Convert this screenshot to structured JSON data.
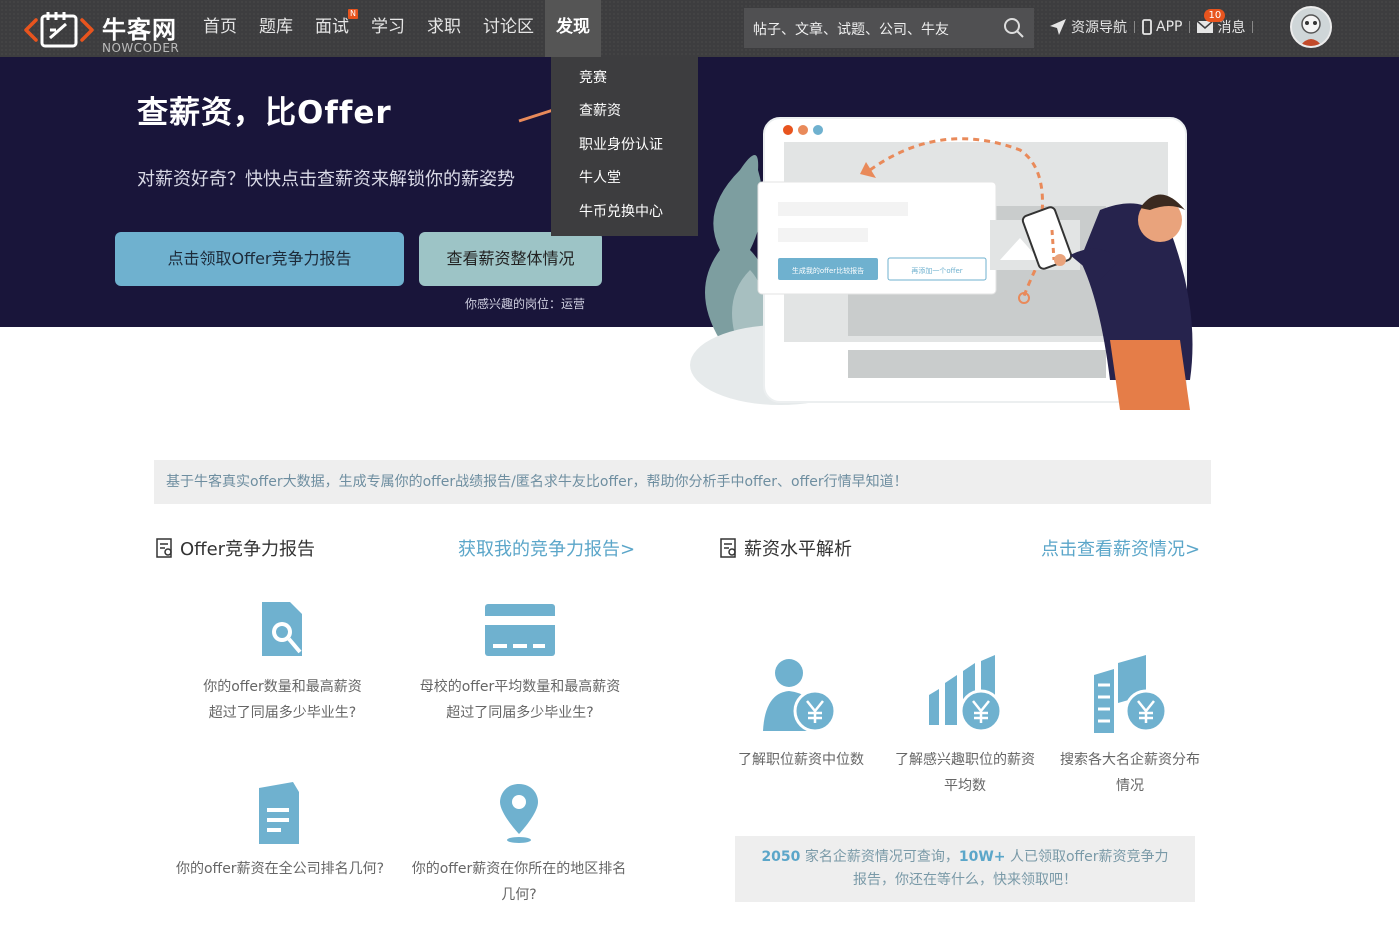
{
  "header": {
    "logo_cn": "牛客网",
    "logo_en": "NOWCODER",
    "nav": [
      {
        "label": "首页"
      },
      {
        "label": "题库"
      },
      {
        "label": "面试",
        "badge": "N"
      },
      {
        "label": "学习"
      },
      {
        "label": "求职"
      },
      {
        "label": "讨论区"
      },
      {
        "label": "发现",
        "active": true
      }
    ],
    "search_placeholder": "帖子、文章、试题、公司、牛友",
    "resource_nav": "资源导航",
    "app": "APP",
    "messages": "消息",
    "message_count": "10"
  },
  "dropdown": [
    "竞赛",
    "查薪资",
    "职业身份认证",
    "牛人堂",
    "牛币兑换中心"
  ],
  "banner": {
    "title": "查薪资，比Offer",
    "subtitle": "对薪资好奇？快快点击查薪资来解锁你的薪姿势",
    "btn_report": "点击领取Offer竞争力报告",
    "btn_salary": "查看薪资整体情况",
    "interest_label": "你感兴趣的岗位：",
    "interest_value": "运营",
    "illus_btn1": "生成我的offer比较报告",
    "illus_btn2": "再添加一个offer"
  },
  "strip": "基于牛客真实offer大数据，生成专属你的offer战绩报告/匿名求牛友比offer，帮助你分析手中offer、offer行情早知道！",
  "offer_section": {
    "title": "Offer竞争力报告",
    "link": "获取我的竞争力报告>",
    "cards": [
      {
        "line1": "你的offer数量和最高薪资",
        "line2": "超过了同届多少毕业生?"
      },
      {
        "line1": "母校的offer平均数量和最高薪资",
        "line2": "超过了同届多少毕业生?"
      },
      {
        "line1": "你的offer薪资在全公司排名几何?",
        "line2": ""
      },
      {
        "line1": "你的offer薪资在你所在的地区排名",
        "line2": "几何?"
      }
    ]
  },
  "salary_section": {
    "title": "薪资水平解析",
    "link": "点击查看薪资情况>",
    "cards": [
      {
        "line1": "了解职位薪资中位数",
        "line2": ""
      },
      {
        "line1": "了解感兴趣职位的薪资",
        "line2": "平均数"
      },
      {
        "line1": "搜索各大名企薪资分布",
        "line2": "情况"
      }
    ]
  },
  "promo": {
    "count1": "2050",
    "text1": " 家名企薪资情况可查询，",
    "count2": "10W+",
    "text2": " 人已领取offer薪资竞争力",
    "line2": "报告，你还在等什么，快来领取吧！"
  },
  "colors": {
    "accent": "#5ba6c9",
    "banner_bg": "#19153a",
    "topbar": "#3d3d3f",
    "brand_orange": "#e8541e"
  }
}
